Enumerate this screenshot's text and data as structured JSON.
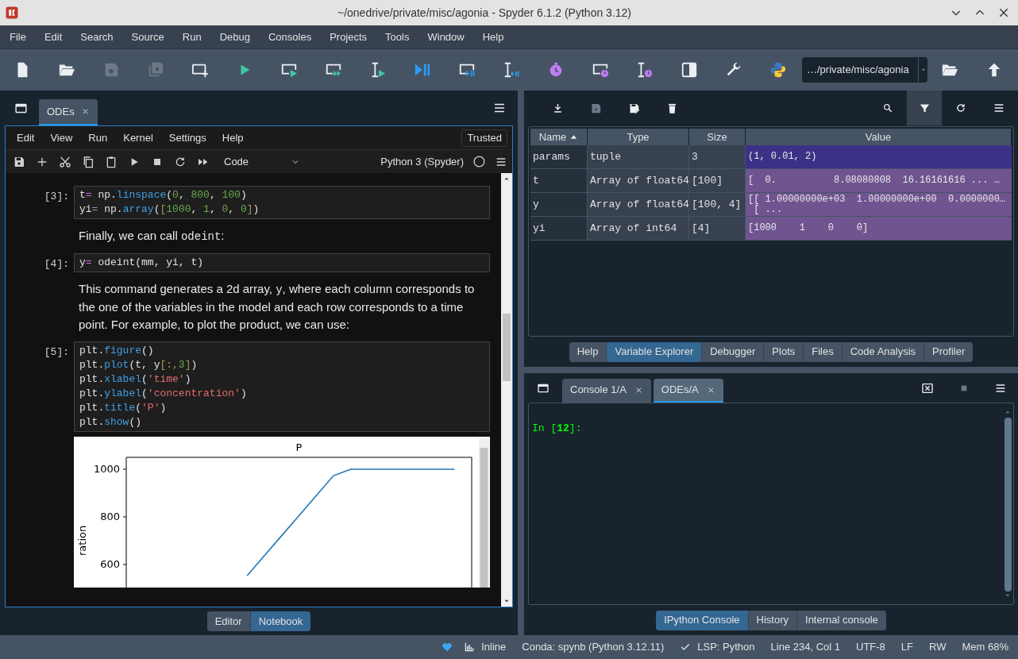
{
  "window": {
    "title": "~/onedrive/private/misc/agonia - Spyder 6.1.2 (Python 3.12)"
  },
  "menu_bar": [
    "File",
    "Edit",
    "Search",
    "Source",
    "Run",
    "Debug",
    "Consoles",
    "Projects",
    "Tools",
    "Window",
    "Help"
  ],
  "toolbar": {
    "working_directory": "…/private/misc/agonia"
  },
  "editor_pane": {
    "tabs": [
      {
        "label": "ODEs",
        "selected": true
      }
    ],
    "notebook": {
      "menu": [
        "Edit",
        "View",
        "Run",
        "Kernel",
        "Settings",
        "Help"
      ],
      "trusted": "Trusted",
      "cell_type": "Code",
      "kernel": "Python 3 (Spyder)",
      "cells": [
        {
          "kind": "code",
          "prompt": "[3]:",
          "lines": [
            [
              {
                "text": "t",
                "kind": "plain"
              },
              {
                "text": "=",
                "kind": "op"
              },
              {
                "text": " np.",
                "kind": "plain"
              },
              {
                "text": "linspace",
                "kind": "func"
              },
              {
                "text": "(",
                "kind": "plain"
              },
              {
                "text": "0",
                "kind": "num"
              },
              {
                "text": ", ",
                "kind": "plain"
              },
              {
                "text": "800",
                "kind": "num"
              },
              {
                "text": ", ",
                "kind": "plain"
              },
              {
                "text": "100",
                "kind": "num"
              },
              {
                "text": ")",
                "kind": "plain"
              }
            ],
            [
              {
                "text": "yi",
                "kind": "plain"
              },
              {
                "text": "=",
                "kind": "op"
              },
              {
                "text": " np.",
                "kind": "plain"
              },
              {
                "text": "array",
                "kind": "func"
              },
              {
                "text": "(",
                "kind": "plain"
              },
              {
                "text": "[",
                "kind": "bracket"
              },
              {
                "text": "1000",
                "kind": "num"
              },
              {
                "text": ", ",
                "kind": "plain"
              },
              {
                "text": "1",
                "kind": "num"
              },
              {
                "text": ", ",
                "kind": "plain"
              },
              {
                "text": "0",
                "kind": "num"
              },
              {
                "text": ", ",
                "kind": "plain"
              },
              {
                "text": "0",
                "kind": "num"
              },
              {
                "text": "]",
                "kind": "bracket"
              },
              {
                "text": ")",
                "kind": "plain"
              }
            ]
          ]
        },
        {
          "kind": "markdown",
          "parts": [
            {
              "text": "Finally, we can call ",
              "kind": "plain"
            },
            {
              "text": "odeint",
              "kind": "code"
            },
            {
              "text": ":",
              "kind": "plain"
            }
          ]
        },
        {
          "kind": "code",
          "prompt": "[4]:",
          "lines": [
            [
              {
                "text": "y",
                "kind": "plain"
              },
              {
                "text": "=",
                "kind": "op"
              },
              {
                "text": " odeint(mm, yi, t)",
                "kind": "plain"
              }
            ]
          ]
        },
        {
          "kind": "markdown",
          "parts": [
            {
              "text": "This command generates a 2d array, ",
              "kind": "plain"
            },
            {
              "text": "y",
              "kind": "code"
            },
            {
              "text": ", where each column corresponds to the one of the variables in the model and each row corresponds to a time point. For example, to plot the product, we can use:",
              "kind": "plain"
            }
          ]
        },
        {
          "kind": "code",
          "prompt": "[5]:",
          "lines": [
            [
              {
                "text": "plt.",
                "kind": "plain"
              },
              {
                "text": "figure",
                "kind": "func"
              },
              {
                "text": "()",
                "kind": "plain"
              }
            ],
            [
              {
                "text": "plt.",
                "kind": "plain"
              },
              {
                "text": "plot",
                "kind": "func"
              },
              {
                "text": "(t, y",
                "kind": "plain"
              },
              {
                "text": "[:,",
                "kind": "bracket"
              },
              {
                "text": "3",
                "kind": "num"
              },
              {
                "text": "]",
                "kind": "bracket"
              },
              {
                "text": ")",
                "kind": "plain"
              }
            ],
            [
              {
                "text": "plt.",
                "kind": "plain"
              },
              {
                "text": "xlabel",
                "kind": "func"
              },
              {
                "text": "(",
                "kind": "plain"
              },
              {
                "text": "'time'",
                "kind": "str"
              },
              {
                "text": ")",
                "kind": "plain"
              }
            ],
            [
              {
                "text": "plt.",
                "kind": "plain"
              },
              {
                "text": "ylabel",
                "kind": "func"
              },
              {
                "text": "(",
                "kind": "plain"
              },
              {
                "text": "'concentration'",
                "kind": "str"
              },
              {
                "text": ")",
                "kind": "plain"
              }
            ],
            [
              {
                "text": "plt.",
                "kind": "plain"
              },
              {
                "text": "title",
                "kind": "func"
              },
              {
                "text": "(",
                "kind": "plain"
              },
              {
                "text": "'P'",
                "kind": "str"
              },
              {
                "text": ")",
                "kind": "plain"
              }
            ],
            [
              {
                "text": "plt.",
                "kind": "plain"
              },
              {
                "text": "show",
                "kind": "func"
              },
              {
                "text": "()",
                "kind": "plain"
              }
            ]
          ],
          "output": {
            "chart_data": {
              "type": "line",
              "title": "P",
              "ylabel": "ration",
              "categories": [
                null,
                null,
                null,
                null,
                null,
                null,
                null,
                null,
                null,
                null,
                null,
                null,
                null,
                null,
                null,
                null,
                null,
                null,
                null,
                null,
                null
              ],
              "series": [
                {
                  "color": "#1f77b4",
                  "values": [
                    null,
                    null,
                    null,
                    null,
                    null,
                    null,
                    null,
                    553,
                    637,
                    721,
                    805,
                    889,
                    973,
                    1000,
                    1000,
                    1000,
                    1000,
                    1000,
                    1000,
                    1000,
                    null
                  ]
                }
              ],
              "ylim": [
                503,
                1050
              ],
              "yticks": [
                600,
                800,
                1000
              ]
            }
          }
        }
      ]
    },
    "bottom_tabs": [
      {
        "label": "Editor",
        "selected": false
      },
      {
        "label": "Notebook",
        "selected": true
      }
    ]
  },
  "variable_explorer": {
    "filter_on": true,
    "columns": [
      {
        "label": "Name",
        "sorted": true
      },
      {
        "label": "Type",
        "sorted": false
      },
      {
        "label": "Size",
        "sorted": false
      },
      {
        "label": "Value",
        "sorted": false
      }
    ],
    "rows": [
      {
        "name": "params",
        "type": "tuple",
        "size": "3",
        "value": [
          "(1, 0.01, 2)"
        ],
        "color": "#3b3287"
      },
      {
        "name": "t",
        "type": "Array of float64",
        "size": "[100]",
        "value": [
          "[  0.          8.08080808  16.16161616 ... …"
        ],
        "color": "#6f5490"
      },
      {
        "name": "y",
        "type": "Array of float64",
        "size": "[100, 4]",
        "value": [
          "[[ 1.00000000e+03  1.00000000e+00  0.0000000…",
          " [ ..."
        ],
        "color": "#6f5490"
      },
      {
        "name": "yi",
        "type": "Array of int64",
        "size": "[4]",
        "value": [
          "[1000    1    0    0]"
        ],
        "color": "#6f5490"
      }
    ]
  },
  "plugin_tabs": [
    {
      "label": "Help",
      "selected": false
    },
    {
      "label": "Variable Explorer",
      "selected": true
    },
    {
      "label": "Debugger",
      "selected": false
    },
    {
      "label": "Plots",
      "selected": false
    },
    {
      "label": "Files",
      "selected": false
    },
    {
      "label": "Code Analysis",
      "selected": false
    },
    {
      "label": "Profiler",
      "selected": false
    }
  ],
  "console": {
    "tabs": [
      {
        "label": "Console 1/A",
        "selected": false
      },
      {
        "label": "ODEs/A",
        "selected": true
      }
    ],
    "prompt": "In [**12**]:"
  },
  "console_tabs": [
    {
      "label": "IPython Console",
      "selected": true
    },
    {
      "label": "History",
      "selected": false
    },
    {
      "label": "Internal console",
      "selected": false
    }
  ],
  "status_bar": {
    "inline": "Inline",
    "conda": "Conda: spynb (Python 3.12.11)",
    "lsp": "LSP: Python",
    "cursor": "Line 234, Col 1",
    "encoding": "UTF-8",
    "eol": "LF",
    "mode": "RW",
    "memory": "Mem 68%"
  }
}
